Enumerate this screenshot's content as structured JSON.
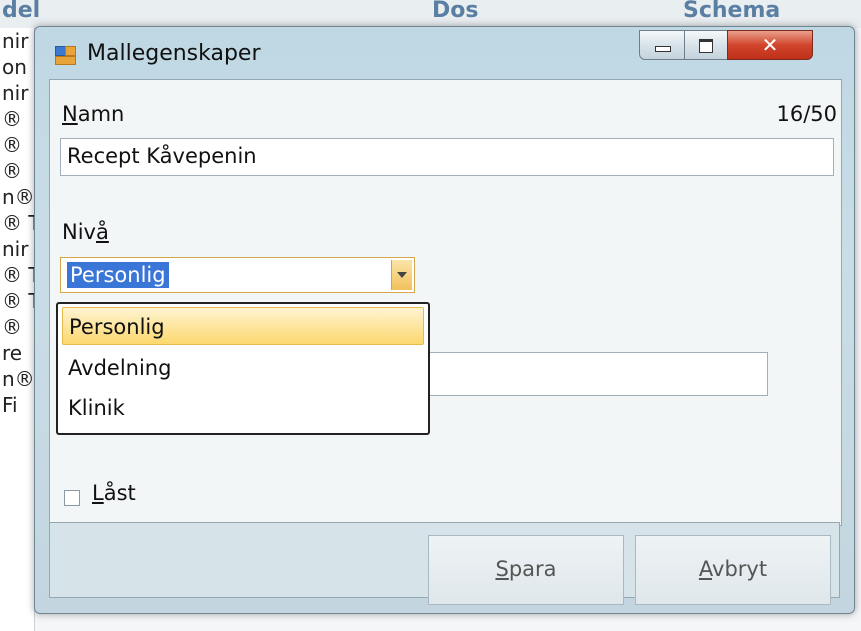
{
  "background": {
    "columns": [
      "del",
      "Dos",
      "Schema"
    ],
    "left_rows": [
      "nir",
      "on",
      "nir",
      "®",
      "®",
      "®",
      "n®",
      "® T",
      "nir",
      "® T",
      "® T",
      "®",
      "re",
      "n®",
      "Fi"
    ]
  },
  "window": {
    "title": "Mallegenskaper",
    "close_glyph": "✕"
  },
  "form": {
    "name_label_u": "N",
    "name_label_rest": "amn",
    "name_counter": "16/50",
    "name_value": "Recept Kåvepenin",
    "level_label_pre": "Niv",
    "level_label_u": "å",
    "level_selected": "Personlig",
    "level_options": [
      "Personlig",
      "Avdelning",
      "Klinik"
    ],
    "locked_label_u": "L",
    "locked_label_rest": "åst",
    "locked_checked": false
  },
  "buttons": {
    "save_u": "S",
    "save_rest": "para",
    "cancel_u": "A",
    "cancel_rest": "vbryt"
  }
}
